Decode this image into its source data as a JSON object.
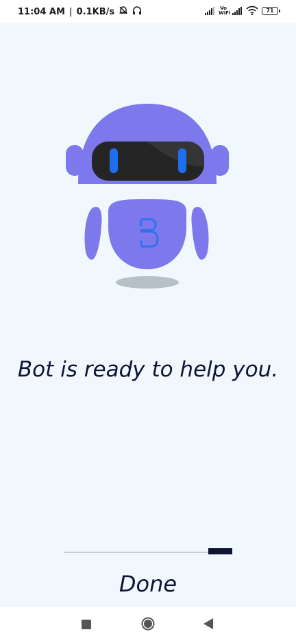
{
  "status_bar": {
    "time": "11:04 AM",
    "separator": "|",
    "network_speed": "0.1KB/s",
    "vowifi_top": "Vo",
    "vowifi_bottom": "WiFi",
    "battery_level": "71"
  },
  "main": {
    "message": "Bot is ready to help you.",
    "progress_fraction": 0.14,
    "done_label": "Done"
  },
  "colors": {
    "background": "#F1F8FD",
    "robot_purple": "#7D78EB",
    "robot_visor": "#252525",
    "robot_eyes": "#1E6FF0",
    "text_dark": "#0E1434"
  },
  "icons": {
    "mute": "bell-off-icon",
    "headphones": "headphones-icon",
    "signal": "signal-icon",
    "wifi": "wifi-icon",
    "battery": "battery-icon",
    "recents": "square-icon",
    "home": "circle-icon",
    "back": "triangle-back-icon"
  }
}
